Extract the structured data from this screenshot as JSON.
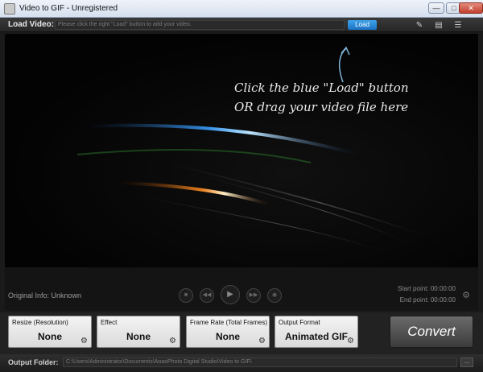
{
  "window": {
    "title": "Video to GIF - Unregistered",
    "min_glyph": "—",
    "max_glyph": "□",
    "close_glyph": "✕"
  },
  "load": {
    "label": "Load Video:",
    "placeholder": "Please click the right \"Load\" button to add your video.",
    "button": "Load"
  },
  "toolbar_icons": [
    "tag-icon",
    "comment-icon",
    "document-icon"
  ],
  "preview": {
    "hint_line1": "Click the blue \"Load\" button",
    "hint_line2": "OR drag your video file here"
  },
  "playback": {
    "original_info": "Original Info: Unknown",
    "start_point": "Start point: 00:00:00",
    "end_point": "End point: 00:00:00"
  },
  "options": {
    "resize": {
      "title": "Resize (Resolution)",
      "value": "None"
    },
    "effect": {
      "title": "Effect",
      "value": "None"
    },
    "frame_rate": {
      "title": "Frame Rate (Total Frames)",
      "value": "None"
    },
    "output_format": {
      "title": "Output Format",
      "value": "Animated GIF"
    }
  },
  "convert_label": "Convert",
  "output": {
    "label": "Output Folder:",
    "path": "C:\\Users\\Administrator\\Documents\\AoaoPhoto Digital Studio\\Video to GIF\\",
    "browse": "..."
  },
  "colors": {
    "accent_blue": "#1b73c4",
    "panel_dark": "#141414",
    "card_light": "#e6e6e6"
  }
}
